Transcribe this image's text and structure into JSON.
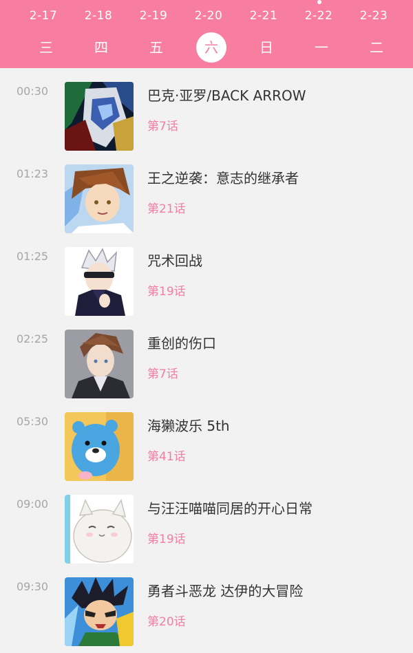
{
  "colors": {
    "accent": "#f77ea0",
    "background": "#f2f2f2",
    "title_text": "#333333",
    "time_text": "#a6a6a6",
    "episode_text": "#f37ea0"
  },
  "days": [
    {
      "date": "2-17",
      "weekday": "三",
      "selected": false
    },
    {
      "date": "2-18",
      "weekday": "四",
      "selected": false
    },
    {
      "date": "2-19",
      "weekday": "五",
      "selected": false
    },
    {
      "date": "2-20",
      "weekday": "六",
      "selected": true
    },
    {
      "date": "2-21",
      "weekday": "日",
      "selected": false
    },
    {
      "date": "2-22",
      "weekday": "一",
      "selected": false
    },
    {
      "date": "2-23",
      "weekday": "二",
      "selected": false
    }
  ],
  "schedule": [
    {
      "time": "00:30",
      "title": "巴克·亚罗/BACK ARROW",
      "episode": "第7话",
      "thumb_icon": "mecha-pilot-icon"
    },
    {
      "time": "01:23",
      "title": "王之逆袭：意志的继承者",
      "episode": "第21话",
      "thumb_icon": "brown-hair-boy-icon"
    },
    {
      "time": "01:25",
      "title": "咒术回战",
      "episode": "第19话",
      "thumb_icon": "white-hair-blindfold-icon"
    },
    {
      "time": "02:25",
      "title": "重创的伤口",
      "episode": "第7话",
      "thumb_icon": "suit-man-icon"
    },
    {
      "time": "05:30",
      "title": "海獭波乐 5th",
      "episode": "第41话",
      "thumb_icon": "blue-otter-icon"
    },
    {
      "time": "09:00",
      "title": "与汪汪喵喵同居的开心日常",
      "episode": "第19话",
      "thumb_icon": "white-cat-icon"
    },
    {
      "time": "09:30",
      "title": "勇者斗恶龙 达伊的大冒险",
      "episode": "第20话",
      "thumb_icon": "spiky-hero-icon"
    }
  ]
}
